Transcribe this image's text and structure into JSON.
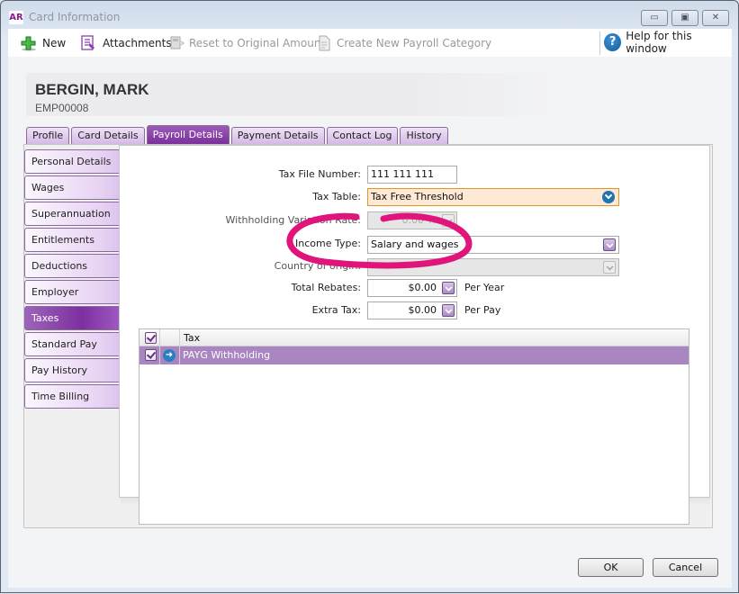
{
  "window": {
    "app_logo": "AR",
    "title": "Card Information",
    "controls": [
      "minimize",
      "maximize",
      "close"
    ]
  },
  "toolbar": {
    "new_label": "New",
    "attachments_label": "Attachments",
    "reset_label": "Reset to Original Amount",
    "create_label": "Create New Payroll Category",
    "help_label": "Help for this window",
    "help_glyph": "?"
  },
  "header": {
    "employee_name": "BERGIN, MARK",
    "employee_id": "EMP00008"
  },
  "tabs": [
    {
      "label": "Profile",
      "active": false
    },
    {
      "label": "Card Details",
      "active": false
    },
    {
      "label": "Payroll Details",
      "active": true
    },
    {
      "label": "Payment Details",
      "active": false
    },
    {
      "label": "Contact Log",
      "active": false
    },
    {
      "label": "History",
      "active": false
    }
  ],
  "sidebar": {
    "items": [
      {
        "label": "Personal Details",
        "active": false
      },
      {
        "label": "Wages",
        "active": false
      },
      {
        "label": "Superannuation",
        "active": false
      },
      {
        "label": "Entitlements",
        "active": false
      },
      {
        "label": "Deductions",
        "active": false
      },
      {
        "label": "Employer Expenses",
        "active": false
      },
      {
        "label": "Taxes",
        "active": true
      },
      {
        "label": "Standard Pay",
        "active": false
      },
      {
        "label": "Pay History",
        "active": false
      },
      {
        "label": "Time Billing",
        "active": false
      }
    ]
  },
  "form": {
    "tax_file_number": {
      "label": "Tax File Number:",
      "value": "111 111 111"
    },
    "tax_table": {
      "label": "Tax Table:",
      "value": "Tax Free Threshold"
    },
    "withholding_variation_rate": {
      "label": "Withholding Variation Rate:",
      "value": "0.00 %"
    },
    "income_type": {
      "label": "Income Type:",
      "value": "Salary and wages"
    },
    "country_of_origin": {
      "label": "Country of origin:",
      "value": ""
    },
    "total_rebates": {
      "label": "Total Rebates:",
      "value": "$0.00",
      "suffix": "Per Year"
    },
    "extra_tax": {
      "label": "Extra Tax:",
      "value": "$0.00",
      "suffix": "Per Pay"
    }
  },
  "tax_grid": {
    "columns": [
      "",
      "",
      "Tax"
    ],
    "rows": [
      {
        "checked": true,
        "name": "PAYG Withholding"
      }
    ]
  },
  "footer": {
    "ok_label": "OK",
    "cancel_label": "Cancel"
  },
  "colors": {
    "accent_purple": "#7a2f9c",
    "highlight_annotation": "#e0147a",
    "selected_row": "#a985c1",
    "tax_table_highlight": "#fde9d4"
  }
}
